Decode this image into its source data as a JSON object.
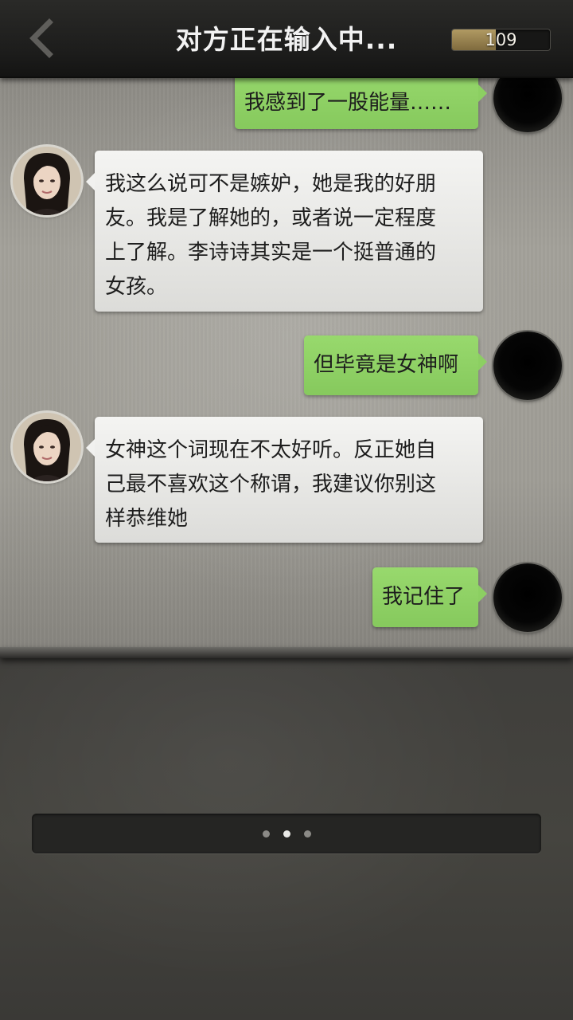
{
  "header": {
    "title": "对方正在输入中...",
    "counter": "109",
    "counter_fill": 0.45
  },
  "messages": [
    {
      "sender": "me",
      "text": "我感到了一股能量……"
    },
    {
      "sender": "her",
      "lines": [
        "我这么说可不是嫉妒，她是我的好朋",
        "友。我是了解她的，或者说一定程度",
        "上了解。李诗诗其实是一个挺普通的",
        "女孩。"
      ]
    },
    {
      "sender": "me",
      "text": "但毕竟是女神啊"
    },
    {
      "sender": "her",
      "lines": [
        "女神这个词现在不太好听。反正她自",
        "己最不喜欢这个称谓，我建议你别这",
        "样恭维她"
      ]
    },
    {
      "sender": "me",
      "text": "我记住了"
    }
  ],
  "typing_indicator": {
    "dots": 3,
    "active_index": 1
  },
  "colors": {
    "my_bubble": "#8fd167",
    "her_bubble": "#eeeeec",
    "topbar": "#1f1f1e"
  },
  "icons": {
    "back": "chevron-left-icon"
  }
}
